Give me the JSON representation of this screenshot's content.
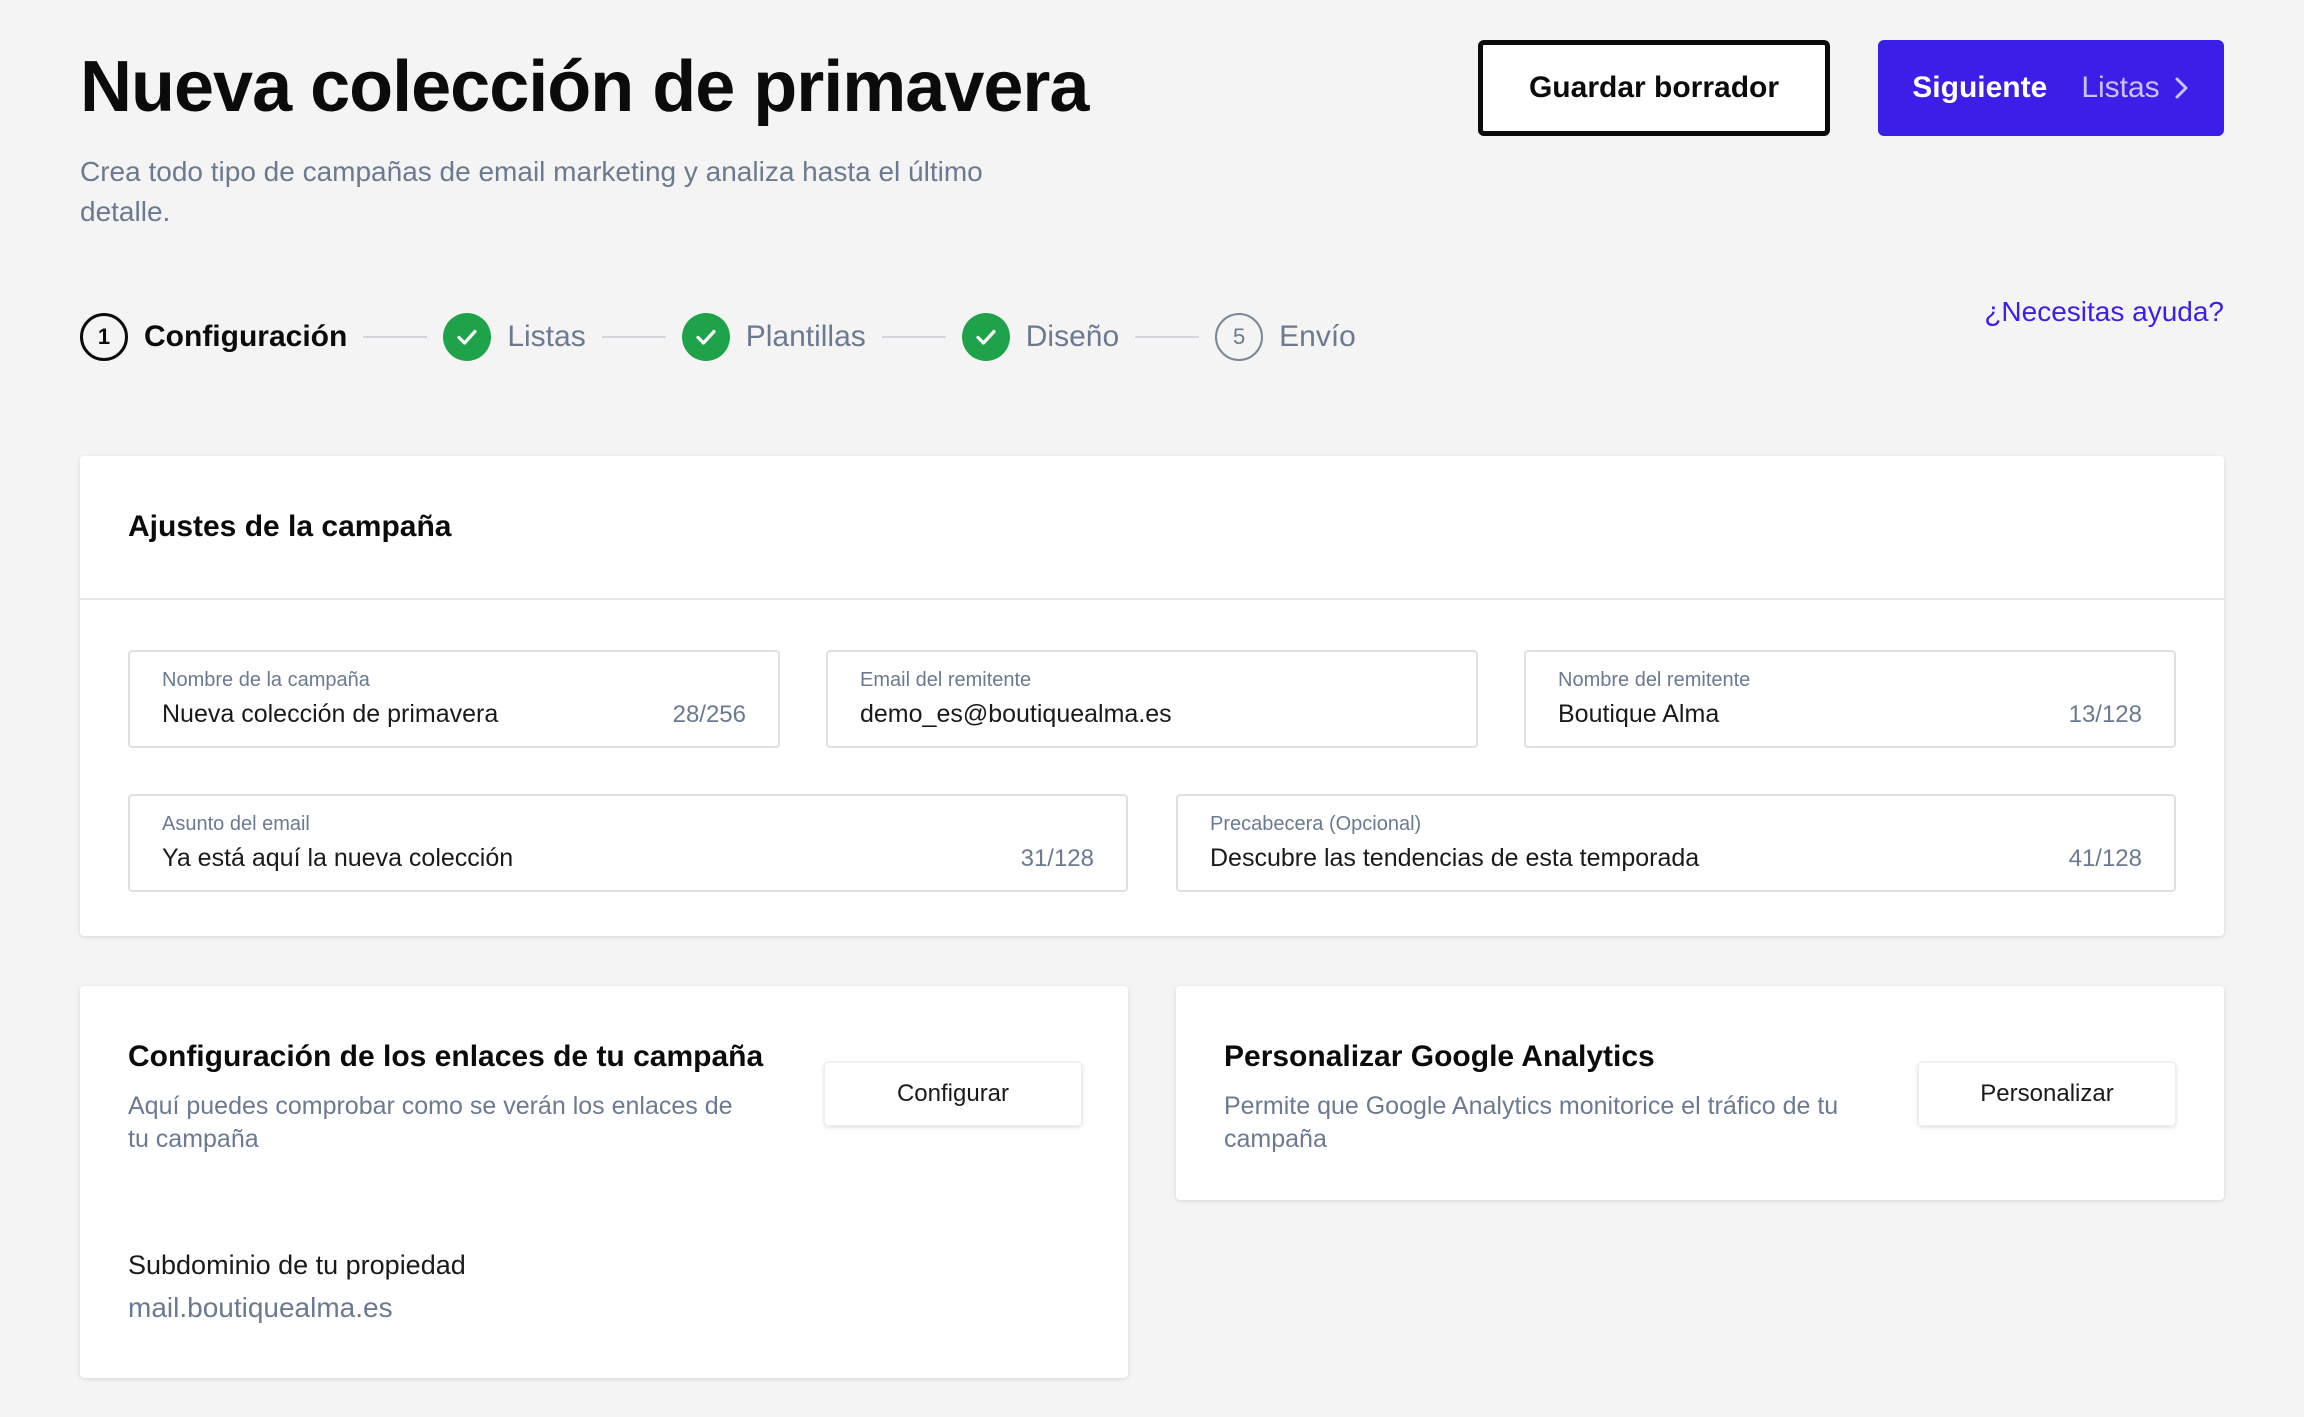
{
  "header": {
    "title": "Nueva colección de primavera",
    "subtitle": "Crea todo tipo de campañas de email marketing y analiza hasta el último detalle.",
    "save_draft_label": "Guardar borrador",
    "next_label": "Siguiente",
    "next_step_label": "Listas"
  },
  "stepper": {
    "help_link": "¿Necesitas ayuda?",
    "steps": [
      {
        "number": "1",
        "label": "Configuración",
        "state": "current"
      },
      {
        "number": "",
        "label": "Listas",
        "state": "done"
      },
      {
        "number": "",
        "label": "Plantillas",
        "state": "done"
      },
      {
        "number": "",
        "label": "Diseño",
        "state": "done"
      },
      {
        "number": "5",
        "label": "Envío",
        "state": "pending"
      }
    ]
  },
  "settings": {
    "title": "Ajustes de la campaña",
    "fields": {
      "campaign_name": {
        "label": "Nombre de la campaña",
        "value": "Nueva colección de primavera",
        "count": "28/256"
      },
      "sender_email": {
        "label": "Email del remitente",
        "value": "demo_es@boutiquealma.es"
      },
      "sender_name": {
        "label": "Nombre del remitente",
        "value": "Boutique Alma",
        "count": "13/128"
      },
      "subject": {
        "label": "Asunto del email",
        "value": "Ya está aquí la nueva colección",
        "count": "31/128"
      },
      "preheader": {
        "label": "Precabecera (Opcional)",
        "value": "Descubre las tendencias de esta temporada",
        "count": "41/128"
      }
    }
  },
  "links_card": {
    "title": "Configuración de los enlaces de tu campaña",
    "description": "Aquí puedes comprobar como se verán los enlaces de tu campaña",
    "button_label": "Configurar",
    "subdomain_label": "Subdominio de tu propiedad",
    "subdomain_value": "mail.boutiquealma.es"
  },
  "ga_card": {
    "title": "Personalizar Google Analytics",
    "description": "Permite que Google Analytics monitorice el tráfico de tu campaña",
    "button_label": "Personalizar"
  },
  "colors": {
    "accent": "#3b1ee8",
    "success": "#1fa34a",
    "muted_text": "#6b7a90",
    "background": "#f4f4f4"
  },
  "icons": {
    "done": "check-icon",
    "next": "chevron-right-icon"
  }
}
